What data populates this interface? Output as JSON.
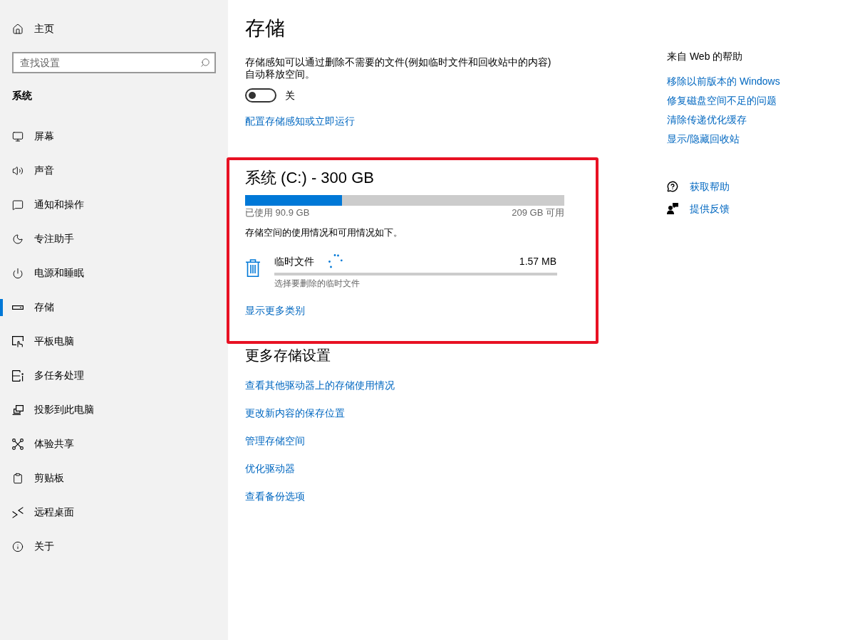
{
  "sidebar": {
    "home": {
      "label": "主页"
    },
    "search": {
      "placeholder": "查找设置"
    },
    "section_title": "系统",
    "items": [
      {
        "label": "屏幕",
        "selected": false
      },
      {
        "label": "声音",
        "selected": false
      },
      {
        "label": "通知和操作",
        "selected": false
      },
      {
        "label": "专注助手",
        "selected": false
      },
      {
        "label": "电源和睡眠",
        "selected": false
      },
      {
        "label": "存储",
        "selected": true
      },
      {
        "label": "平板电脑",
        "selected": false
      },
      {
        "label": "多任务处理",
        "selected": false
      },
      {
        "label": "投影到此电脑",
        "selected": false
      },
      {
        "label": "体验共享",
        "selected": false
      },
      {
        "label": "剪贴板",
        "selected": false
      },
      {
        "label": "远程桌面",
        "selected": false
      },
      {
        "label": "关于",
        "selected": false
      }
    ]
  },
  "page": {
    "title": "存储",
    "storage_sense": {
      "description": "存储感知可以通过删除不需要的文件(例如临时文件和回收站中的内容)自动释放空间。",
      "toggle": {
        "on": false,
        "label": "关"
      },
      "link": "配置存储感知或立即运行"
    },
    "drive": {
      "highlighted": true,
      "title": "系统 (C:) - 300 GB",
      "level": 0.303,
      "used": "已使用 90.9 GB",
      "free": "209 GB 可用",
      "summary": "存储空间的使用情况和可用情况如下。",
      "categories": [
        {
          "name": "临时文件",
          "loading": true,
          "size": "1.57 MB",
          "hint": "选择要删除的临时文件"
        }
      ],
      "more_link": "显示更多类别"
    },
    "more_settings": {
      "title": "更多存储设置",
      "links": [
        "查看其他驱动器上的存储使用情况",
        "更改新内容的保存位置",
        "管理存储空间",
        "优化驱动器",
        "查看备份选项"
      ]
    }
  },
  "help": {
    "title": "来自 Web 的帮助",
    "links": [
      "移除以前版本的 Windows",
      "修复磁盘空间不足的问题",
      "清除传递优化缓存",
      "显示/隐藏回收站"
    ],
    "actions": [
      {
        "label": "获取帮助"
      },
      {
        "label": "提供反馈"
      }
    ]
  }
}
